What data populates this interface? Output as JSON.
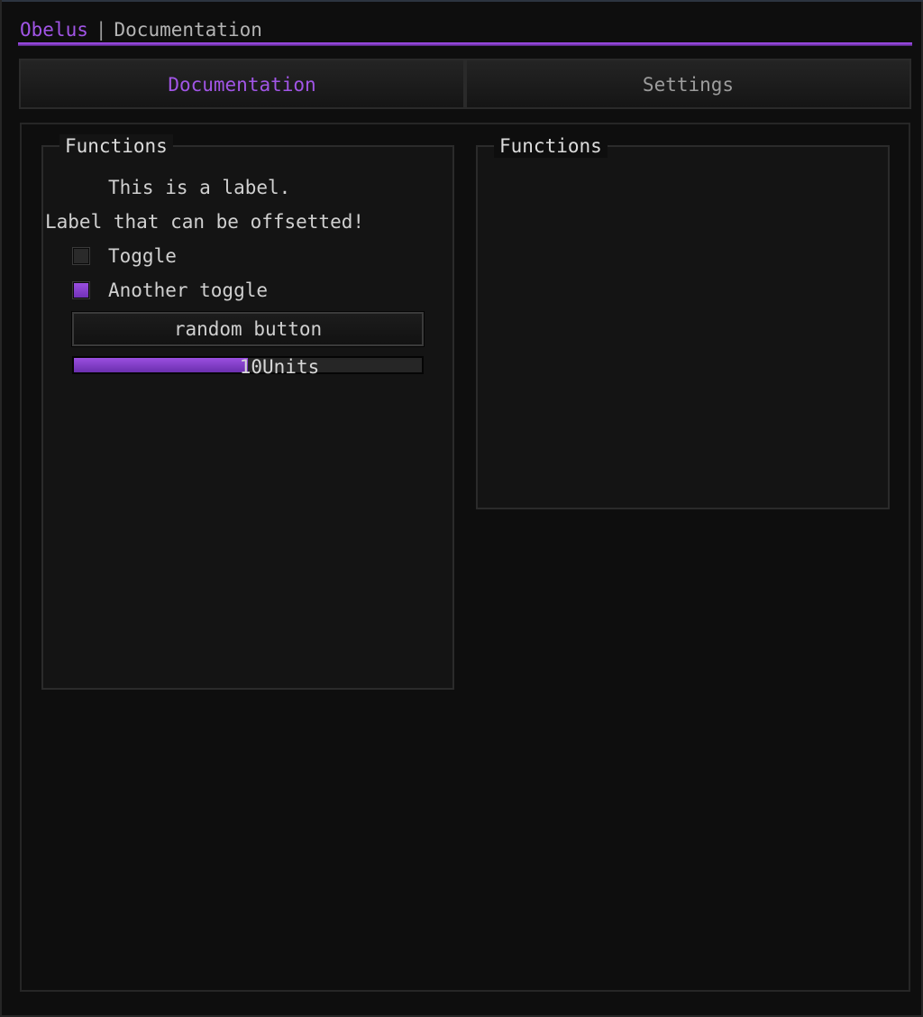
{
  "titlebar": {
    "brand": "Obelus",
    "separator": "|",
    "page": "Documentation"
  },
  "tabs": [
    {
      "label": "Documentation",
      "active": true
    },
    {
      "label": "Settings",
      "active": false
    }
  ],
  "groups": {
    "left": {
      "title": "Functions",
      "label_1": "This is a label.",
      "label_2": "Label that can be offsetted!",
      "toggles": [
        {
          "label": "Toggle",
          "checked": false
        },
        {
          "label": "Another toggle",
          "checked": true
        }
      ],
      "button_label": "random button",
      "slider": {
        "value": 10,
        "min": 0,
        "max": 20,
        "suffix": "Units",
        "display": "10Units"
      }
    },
    "right": {
      "title": "Functions"
    }
  },
  "colors": {
    "accent": "#a155e6",
    "background": "#0e0e0e",
    "panel": "#141414"
  }
}
